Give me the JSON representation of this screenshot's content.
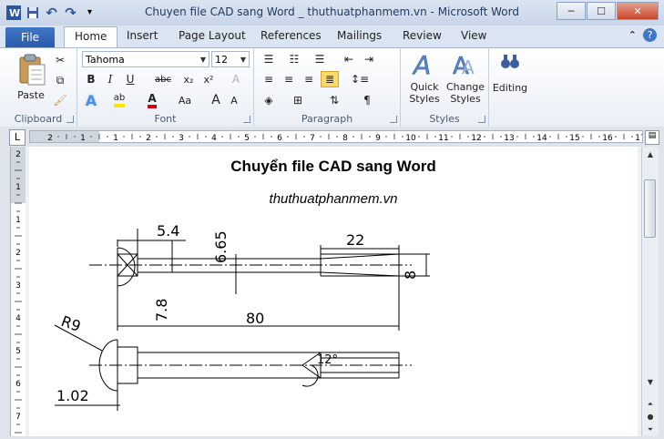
{
  "window": {
    "title": "Chuyen file CAD sang Word _ thuthuatphanmem.vn  -  Microsoft Word",
    "controls": {
      "minimize": "─",
      "maximize": "☐",
      "close": "✕"
    }
  },
  "qat": {
    "app_icon": "W",
    "undo_glyph": "↶",
    "redo_glyph": "↷",
    "customize_glyph": "▾"
  },
  "tabs": {
    "file": "File",
    "items": [
      "Home",
      "Insert",
      "Page Layout",
      "References",
      "Mailings",
      "Review",
      "View"
    ],
    "active": "Home"
  },
  "ribbon": {
    "clipboard": {
      "label": "Clipboard",
      "paste": "Paste"
    },
    "font": {
      "label": "Font",
      "font_name": "Tahoma",
      "font_size": "12",
      "bold": "B",
      "italic": "I",
      "underline": "U",
      "strike": "abc",
      "subscript": "x₂",
      "superscript": "x²",
      "grow": "A",
      "shrink": "A",
      "case": "Aa",
      "highlight": "ab",
      "font_color": "A",
      "clear": "A"
    },
    "paragraph": {
      "label": "Paragraph",
      "pilcrow": "¶"
    },
    "styles": {
      "label": "Styles",
      "quick_styles": "Quick Styles",
      "change_styles": "Change Styles"
    },
    "editing": {
      "label": "Editing"
    }
  },
  "ruler": {
    "tab_selector": "L",
    "h_numbers": [
      "2",
      "1",
      "1",
      "2",
      "3",
      "4",
      "5",
      "6",
      "7",
      "8",
      "9",
      "10",
      "11",
      "12",
      "13",
      "14",
      "15",
      "16",
      "17"
    ],
    "v_numbers": [
      "2",
      "1",
      "1",
      "2",
      "3",
      "4",
      "5",
      "6",
      "7"
    ]
  },
  "document": {
    "title": "Chuyển file CAD sang Word",
    "subtitle": "thuthuatphanmem.vn",
    "drawing_labels": {
      "d1": "5.4",
      "d2": "6.65",
      "d3": "22",
      "d4": "8",
      "d5": "7.8",
      "d6": "80",
      "d7": "R9",
      "d8": "12°",
      "d9": "1.02"
    }
  },
  "colors": {
    "title_blue": "#1e395b",
    "file_tab": "#2a5ba9",
    "highlight_yellow": "#ffe600",
    "font_red": "#d0021b"
  }
}
